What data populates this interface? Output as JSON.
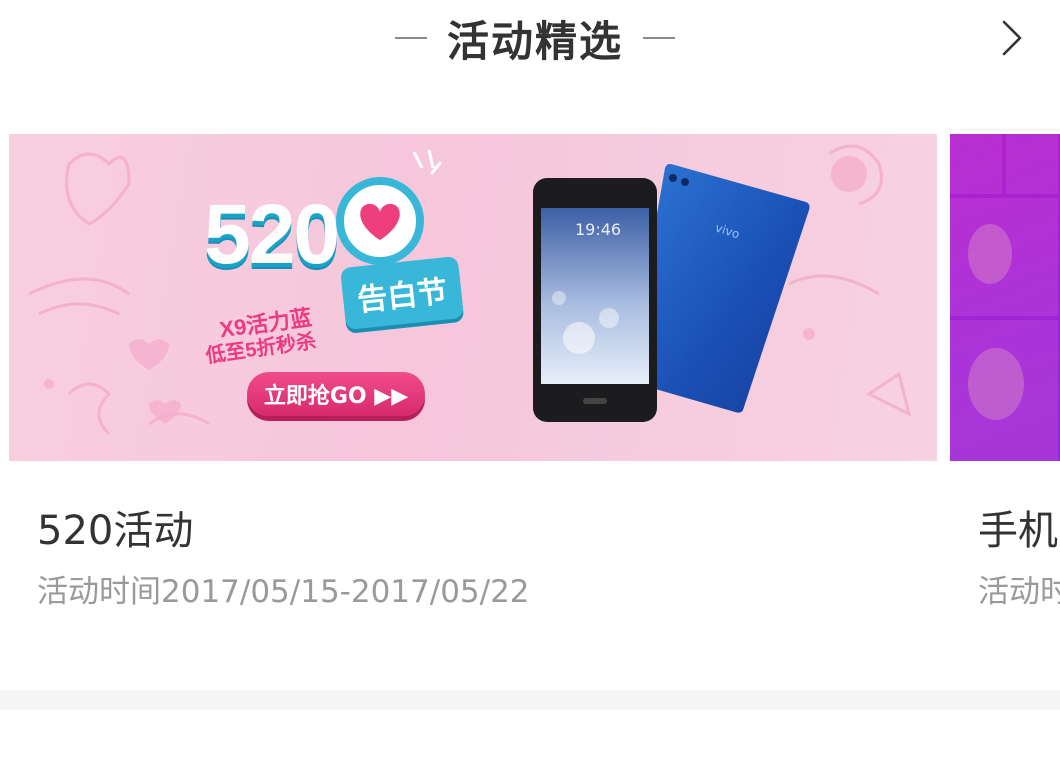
{
  "header": {
    "title": "活动精选",
    "more_icon": "chevron-right-icon"
  },
  "activities": [
    {
      "title": "520活动",
      "date": "活动时间2017/05/15-2017/05/22",
      "banner": {
        "badge_number": "520",
        "promo_line1": "X9活力蓝",
        "promo_line2": "低至5折秒杀",
        "bubble_text": "告白节",
        "cta": "立即抢GO ▶▶",
        "phone_time": "19:46",
        "phone_brand": "vivo",
        "colors": {
          "bg": "#f7cde0",
          "accent": "#39b7d9",
          "cta": "#e8387a"
        }
      }
    },
    {
      "title": "手机",
      "date": "活动时",
      "banner": {
        "colors": {
          "bg": "#a222d0"
        }
      }
    }
  ],
  "colors": {
    "title": "#333333",
    "subtitle": "#9a9a9a",
    "divider_band": "#f5f5f5"
  }
}
